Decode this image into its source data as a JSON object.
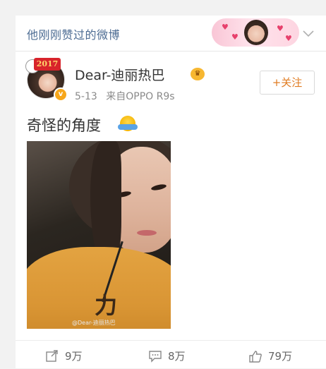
{
  "liked_section": {
    "title": "他刚刚赞过的微博"
  },
  "post": {
    "author_name": "Dear-迪丽热巴",
    "avatar_badge": "2017",
    "date": "5-13",
    "source": "来自OPPO R9s",
    "follow_label": "+关注",
    "text": "奇怪的角度",
    "photo_watermark": "@Dear-迪丽热巴",
    "photo_text": "力",
    "actions": {
      "repost_count": "9万",
      "comment_count": "8万",
      "like_count": "79万"
    }
  },
  "colors": {
    "link_blue": "#4d6c93",
    "follow_orange": "#e07c22",
    "verified_gold": "#f7a71b"
  },
  "icons": [
    "chevron-down-icon",
    "verified-icon",
    "vip-icon",
    "emoji-icon",
    "repost-icon",
    "comment-icon",
    "like-icon"
  ]
}
